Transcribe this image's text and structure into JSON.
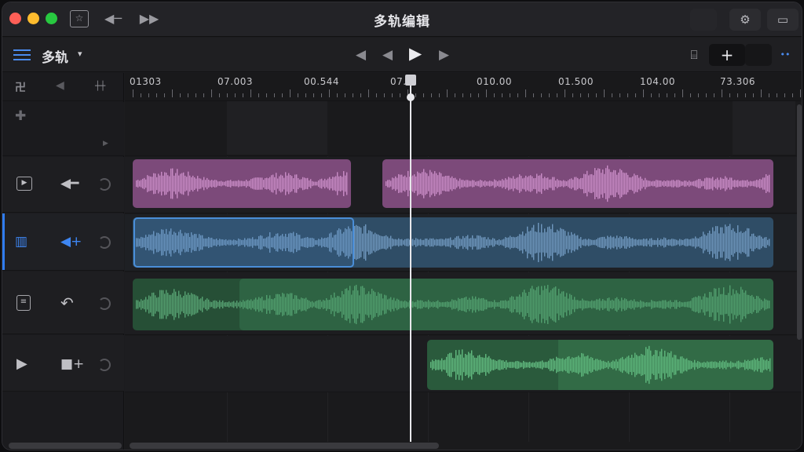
{
  "window": {
    "title": "多轨编辑"
  },
  "toolbar": {
    "view_label": "多轨",
    "caret": "▾",
    "prev_marker": "◀",
    "rewind": "◀",
    "play": "▶",
    "forward": "▶",
    "add": "+",
    "more": "••"
  },
  "ruler": {
    "labels": [
      "01303",
      "07.003",
      "00.544",
      "07.0",
      "010.00",
      "01.500",
      "104.00",
      "73.306"
    ]
  },
  "colors": {
    "accent": "#2f7cf0",
    "clip_pink": "#9a5a96",
    "clip_blue": "#3a5f7e",
    "clip_green": "#2f6a44",
    "playhead": "#e8e8ec"
  },
  "tracks": [
    {
      "icon": "play-in-box-icon",
      "action": "back-arrow-icon"
    },
    {
      "icon": "columns-icon",
      "action": "add-voice-icon"
    },
    {
      "icon": "clipboard-icon",
      "action": "undo-icon"
    },
    {
      "icon": "play-icon",
      "action": "add-camera-icon"
    }
  ]
}
